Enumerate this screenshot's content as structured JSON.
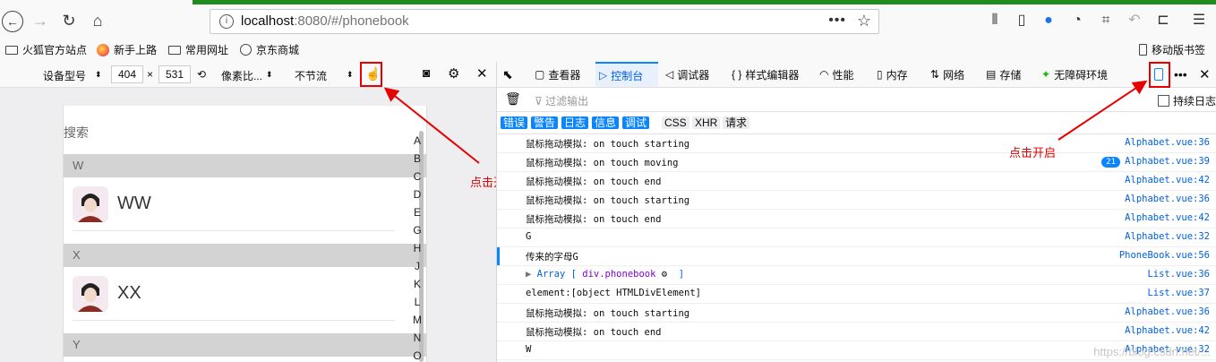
{
  "browser": {
    "url_host": "localhost",
    "url_rest": ":8080/#/phonebook",
    "url_dots": "•••"
  },
  "bookmarks": {
    "items": [
      {
        "label": "火狐官方站点",
        "icon": "folder-icon"
      },
      {
        "label": "新手上路",
        "icon": "firefox-icon"
      },
      {
        "label": "常用网址",
        "icon": "folder-icon"
      },
      {
        "label": "京东商城",
        "icon": "globe-icon"
      }
    ],
    "mobile": "移动版书签"
  },
  "rdm": {
    "device_label": "设备型号",
    "width": "404",
    "times": "×",
    "height": "531",
    "pixel_ratio": "像素比...",
    "throttle": "不节流"
  },
  "phone": {
    "search_label": "搜索",
    "groups": [
      {
        "letter": "W",
        "contact": "WW"
      },
      {
        "letter": "X",
        "contact": "XX"
      },
      {
        "letter": "Y"
      }
    ],
    "index_letters": [
      "A",
      "B",
      "C",
      "D",
      "E",
      "G",
      "H",
      "J",
      "K",
      "L",
      "M",
      "N",
      "O"
    ]
  },
  "annotations": {
    "left": "点击开启",
    "right": "点击开启"
  },
  "devtools": {
    "tabs": [
      "查看器",
      "控制台",
      "调试器",
      "样式编辑器",
      "性能",
      "内存",
      "网络",
      "存储",
      "无障碍环境"
    ],
    "filter_placeholder": "过滤输出",
    "persist_logs": "持续日志",
    "categories_on": [
      "错误",
      "警告",
      "日志",
      "信息",
      "调试"
    ],
    "categories_off": [
      "CSS",
      "XHR",
      "请求"
    ],
    "logs": [
      {
        "msg": "鼠标拖动模拟: on touch starting",
        "src": "Alphabet.vue:36"
      },
      {
        "msg": "鼠标拖动模拟: on touch moving",
        "src": "Alphabet.vue:39",
        "count": "21"
      },
      {
        "msg": "鼠标拖动模拟: on touch end",
        "src": "Alphabet.vue:42"
      },
      {
        "msg": "鼠标拖动模拟: on touch starting",
        "src": "Alphabet.vue:36"
      },
      {
        "msg": "鼠标拖动模拟: on touch end",
        "src": "Alphabet.vue:42"
      },
      {
        "msg": "G",
        "src": "Alphabet.vue:32"
      },
      {
        "msg": "传来的字母G",
        "src": "PhoneBook.vue:56"
      },
      {
        "msg": "",
        "src": "List.vue:36",
        "array": {
          "label": "Array [",
          "el": "div.phonebook",
          "end": "]"
        }
      },
      {
        "msg": "element:[object HTMLDivElement]",
        "src": "List.vue:37"
      },
      {
        "msg": "鼠标拖动模拟: on touch starting",
        "src": "Alphabet.vue:36"
      },
      {
        "msg": "鼠标拖动模拟: on touch end",
        "src": "Alphabet.vue:42"
      },
      {
        "msg": "W",
        "src": "Alphabet.vue:32"
      }
    ]
  },
  "watermark": "https://blog.csdn.net/..."
}
